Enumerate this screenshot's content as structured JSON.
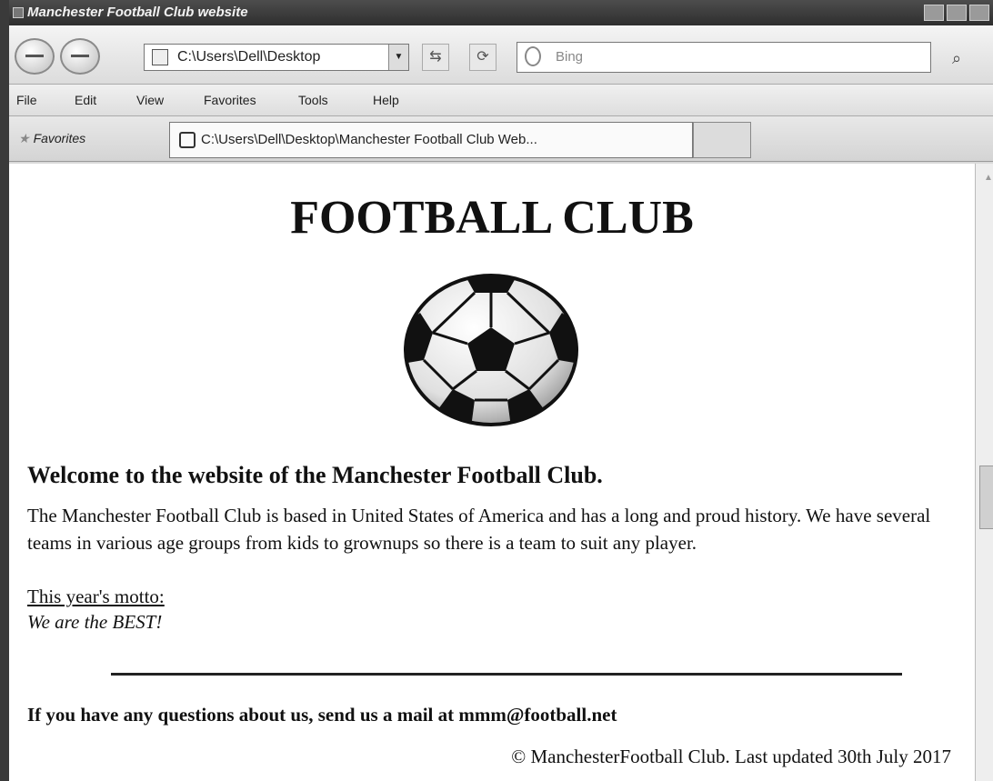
{
  "window": {
    "title": "Manchester Football Club website"
  },
  "toolbar": {
    "address": "C:\\Users\\Dell\\Desktop",
    "search_placeholder": "Bing"
  },
  "menu": [
    "File",
    "Edit",
    "View",
    "Favorites",
    "Tools",
    "Help"
  ],
  "favorites_label": "Favorites",
  "tab_label": "C:\\Users\\Dell\\Desktop\\Manchester Football Club Web...",
  "page": {
    "title": "FOOTBALL CLUB",
    "welcome": "Welcome to the website of the Manchester Football Club.",
    "intro": "The Manchester Football Club is based in United States of America and has a long and proud history. We have several teams in various age groups from kids to grownups so there is a team to suit any player.",
    "motto_label": "This year's motto:",
    "motto": "We are the BEST!",
    "contact": "If you have any questions about us, send us a mail at mmm@football.net",
    "footer": "© ManchesterFootball Club. Last updated 30th July 2017"
  },
  "icons": {
    "back": "back-arrow-icon",
    "forward": "forward-arrow-icon",
    "page": "page-icon",
    "search": "search-icon",
    "favorites": "star-icon",
    "tab": "ie-icon"
  }
}
